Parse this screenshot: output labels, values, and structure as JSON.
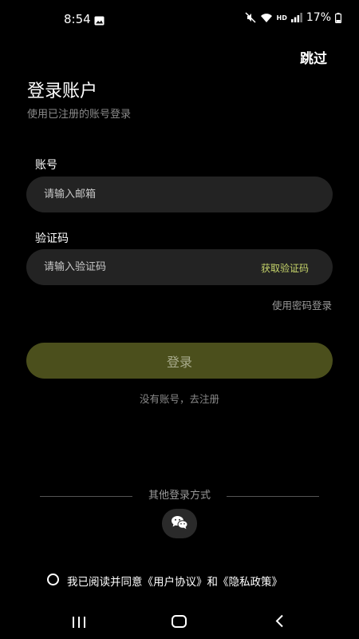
{
  "status_bar": {
    "time": "8:54",
    "network_label": "HD",
    "battery": "17%"
  },
  "header": {
    "skip_label": "跳过"
  },
  "main": {
    "title": "登录账户",
    "subtitle": "使用已注册的账号登录",
    "account": {
      "label": "账号",
      "placeholder": "请输入邮箱",
      "value": ""
    },
    "code": {
      "label": "验证码",
      "placeholder": "请输入验证码",
      "value": "",
      "get_code_label": "获取验证码"
    },
    "password_login_label": "使用密码登录",
    "login_button_label": "登录",
    "register_label": "没有账号，去注册"
  },
  "other_login": {
    "label": "其他登录方式",
    "icons": [
      "wechat-icon"
    ]
  },
  "agreement": {
    "prefix": "我已阅读并同意",
    "user_agreement": "《用户协议》",
    "and": "和",
    "privacy_policy": "《隐私政策》",
    "checked": false
  },
  "colors": {
    "background": "#000000",
    "field_background": "#232323",
    "accent": "#c6d46a",
    "login_button": "#4b4f1c"
  }
}
